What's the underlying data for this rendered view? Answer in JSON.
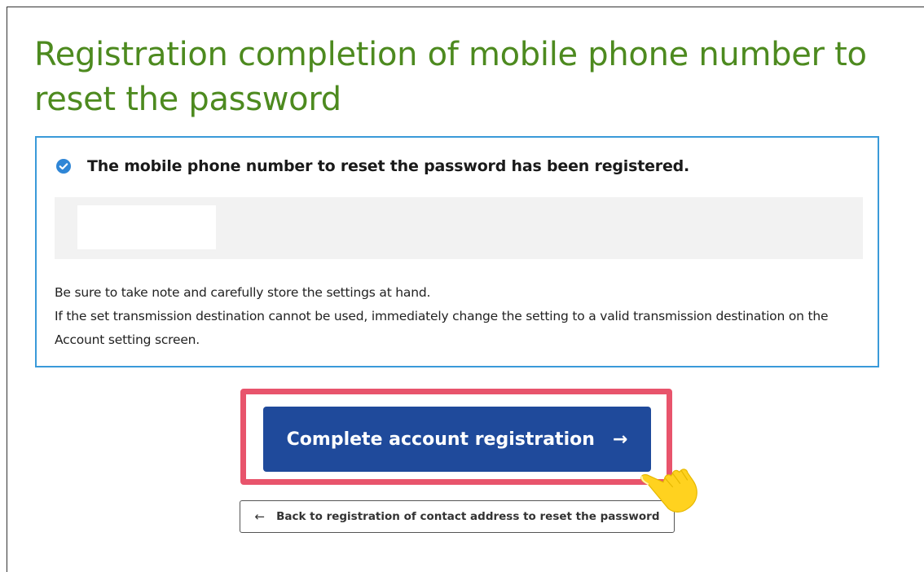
{
  "page": {
    "title": "Registration completion of mobile phone number to reset the password"
  },
  "notice": {
    "icon": "check-circle-icon",
    "heading": "The mobile phone number to reset the password has been registered.",
    "value": "",
    "note_line1": "Be sure to take note and carefully store the settings at hand.",
    "note_line2": "If the set transmission destination cannot be used, immediately change the setting to a valid transmission destination on the Account setting screen."
  },
  "actions": {
    "complete_label": "Complete account registration",
    "complete_icon": "arrow-right-icon",
    "back_label": "Back to registration of contact address to reset the password",
    "back_icon": "arrow-left-icon"
  },
  "overlay": {
    "pointer_icon": "pointing-hand-icon"
  },
  "colors": {
    "title": "#4d8a1f",
    "notice_border": "#3a9ad9",
    "primary_button": "#1f4a9b",
    "highlight_frame": "#e8546c",
    "hand": "#ffd21f"
  }
}
